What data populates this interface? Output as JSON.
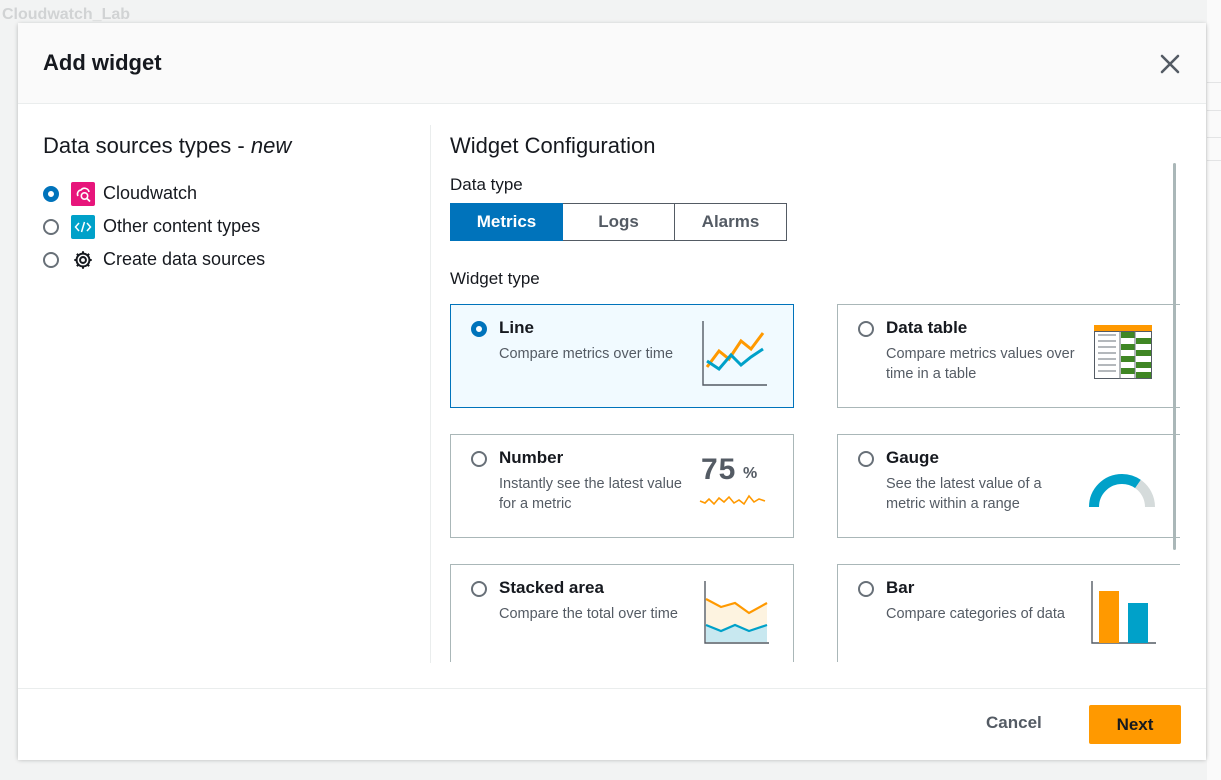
{
  "background": {
    "title": "Cloudwatch_Lab"
  },
  "modal": {
    "title": "Add widget"
  },
  "data_sources": {
    "title": "Data sources types - ",
    "title_emphasis": "new",
    "items": [
      {
        "label": "Cloudwatch",
        "icon": "cloudwatch-icon",
        "selected": true
      },
      {
        "label": "Other content types",
        "icon": "code-icon",
        "selected": false
      },
      {
        "label": "Create data sources",
        "icon": "gear-icon",
        "selected": false
      }
    ]
  },
  "config": {
    "title": "Widget Configuration",
    "data_type_label": "Data type",
    "data_types": [
      "Metrics",
      "Logs",
      "Alarms"
    ],
    "selected_data_type": "Metrics",
    "widget_type_label": "Widget type",
    "widgets": [
      {
        "name": "Line",
        "desc": "Compare metrics over time",
        "icon": "line-chart-icon",
        "selected": true
      },
      {
        "name": "Data table",
        "desc": "Compare metrics values over time in a table",
        "icon": "data-table-icon",
        "selected": false
      },
      {
        "name": "Number",
        "desc": "Instantly see the latest value for a metric",
        "icon": "number-icon",
        "selected": false,
        "art_value": "75",
        "art_unit": "%"
      },
      {
        "name": "Gauge",
        "desc": "See the latest value of a metric within a range",
        "icon": "gauge-icon",
        "selected": false
      },
      {
        "name": "Stacked area",
        "desc": "Compare the total over time",
        "icon": "stacked-area-icon",
        "selected": false
      },
      {
        "name": "Bar",
        "desc": "Compare categories of data",
        "icon": "bar-chart-icon",
        "selected": false
      }
    ]
  },
  "footer": {
    "cancel_label": "Cancel",
    "next_label": "Next"
  },
  "colors": {
    "primary": "#0073bb",
    "accent": "#ff9900",
    "teal": "#00a1c9",
    "green": "#3f8624",
    "cloudwatch": "#e7157b"
  }
}
